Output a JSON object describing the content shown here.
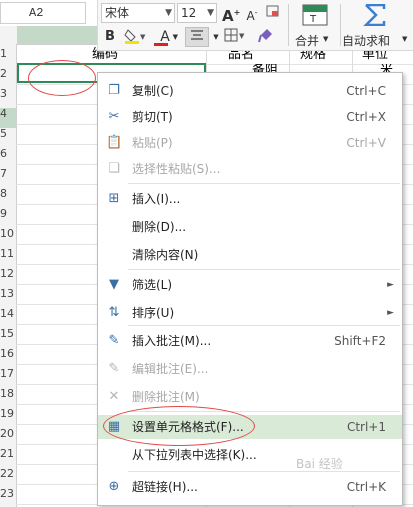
{
  "name_box": {
    "value": "A2"
  },
  "toolbar": {
    "font_name": "宋体",
    "font_size": "12",
    "grow_font": "A",
    "shrink_font": "A",
    "bold": "B",
    "font_color_letter": "A",
    "merge_label": "合并",
    "autosum_label": "自动求和"
  },
  "sheet": {
    "row_numbers": [
      "1",
      "2",
      "3",
      "4",
      "5",
      "6",
      "7",
      "8",
      "9",
      "10",
      "11",
      "12",
      "13",
      "14",
      "15",
      "16",
      "17",
      "18",
      "19",
      "20",
      "21",
      "22",
      "23"
    ],
    "header_cells": [
      "编码",
      "品名",
      "规格",
      "单位"
    ],
    "row2_partial": [
      "备阻",
      "米"
    ]
  },
  "menu": {
    "items": [
      {
        "icon": "copy-icon",
        "label": "复制(C)",
        "shortcut": "Ctrl+C",
        "disabled": false
      },
      {
        "icon": "cut-icon",
        "label": "剪切(T)",
        "shortcut": "Ctrl+X",
        "disabled": false
      },
      {
        "icon": "paste-icon",
        "label": "粘贴(P)",
        "shortcut": "Ctrl+V",
        "disabled": true
      },
      {
        "icon": "paste-special-icon",
        "label": "选择性粘贴(S)...",
        "shortcut": "",
        "disabled": true
      },
      {
        "icon": "insert-icon",
        "label": "插入(I)...",
        "shortcut": "",
        "disabled": false
      },
      {
        "icon": "",
        "label": "删除(D)...",
        "shortcut": "",
        "disabled": false
      },
      {
        "icon": "",
        "label": "清除内容(N)",
        "shortcut": "",
        "disabled": false
      },
      {
        "icon": "filter-icon",
        "label": "筛选(L)",
        "shortcut": "",
        "disabled": false,
        "submenu": true
      },
      {
        "icon": "sort-icon",
        "label": "排序(U)",
        "shortcut": "",
        "disabled": false,
        "submenu": true
      },
      {
        "icon": "comment-add-icon",
        "label": "插入批注(M)...",
        "shortcut": "Shift+F2",
        "disabled": false
      },
      {
        "icon": "comment-edit-icon",
        "label": "编辑批注(E)...",
        "shortcut": "",
        "disabled": true
      },
      {
        "icon": "comment-delete-icon",
        "label": "删除批注(M)",
        "shortcut": "",
        "disabled": true
      },
      {
        "icon": "format-cells-icon",
        "label": "设置单元格格式(F)...",
        "shortcut": "Ctrl+1",
        "disabled": false,
        "highlighted": true
      },
      {
        "icon": "",
        "label": "从下拉列表中选择(K)...",
        "shortcut": "",
        "disabled": false
      },
      {
        "icon": "hyperlink-icon",
        "label": "超链接(H)...",
        "shortcut": "Ctrl+K",
        "disabled": false
      }
    ]
  },
  "watermark": "Bai 经验",
  "colors": {
    "accent_green": "#2e8b57",
    "highlight": "#d9ead6",
    "annotation_red": "#e04a4a",
    "icon_blue": "#3a6ea5"
  }
}
